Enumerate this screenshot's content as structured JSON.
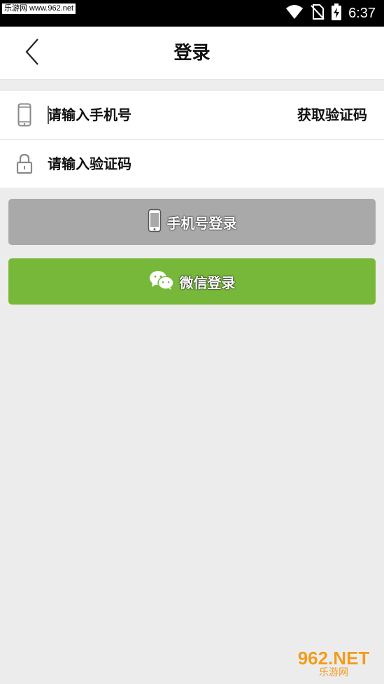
{
  "status_bar": {
    "watermark": "乐游网 www.962.net",
    "time": "6:37",
    "icons": [
      "wifi-icon",
      "no-sim-icon",
      "battery-charging-icon"
    ]
  },
  "header": {
    "title": "登录",
    "back_icon": "chevron-left-icon"
  },
  "form": {
    "phone": {
      "icon": "phone-icon",
      "placeholder": "请输入手机号",
      "value": ""
    },
    "get_code_label": "获取验证码",
    "code": {
      "icon": "lock-icon",
      "placeholder": "请输入验证码",
      "value": ""
    }
  },
  "buttons": {
    "phone_login": {
      "label": "手机号登录",
      "icon": "phone-icon",
      "color": "#a9a9a9"
    },
    "wechat_login": {
      "label": "微信登录",
      "icon": "wechat-icon",
      "color": "#77b83b"
    }
  },
  "watermark": {
    "big": "962.NET",
    "small": "乐游网"
  }
}
